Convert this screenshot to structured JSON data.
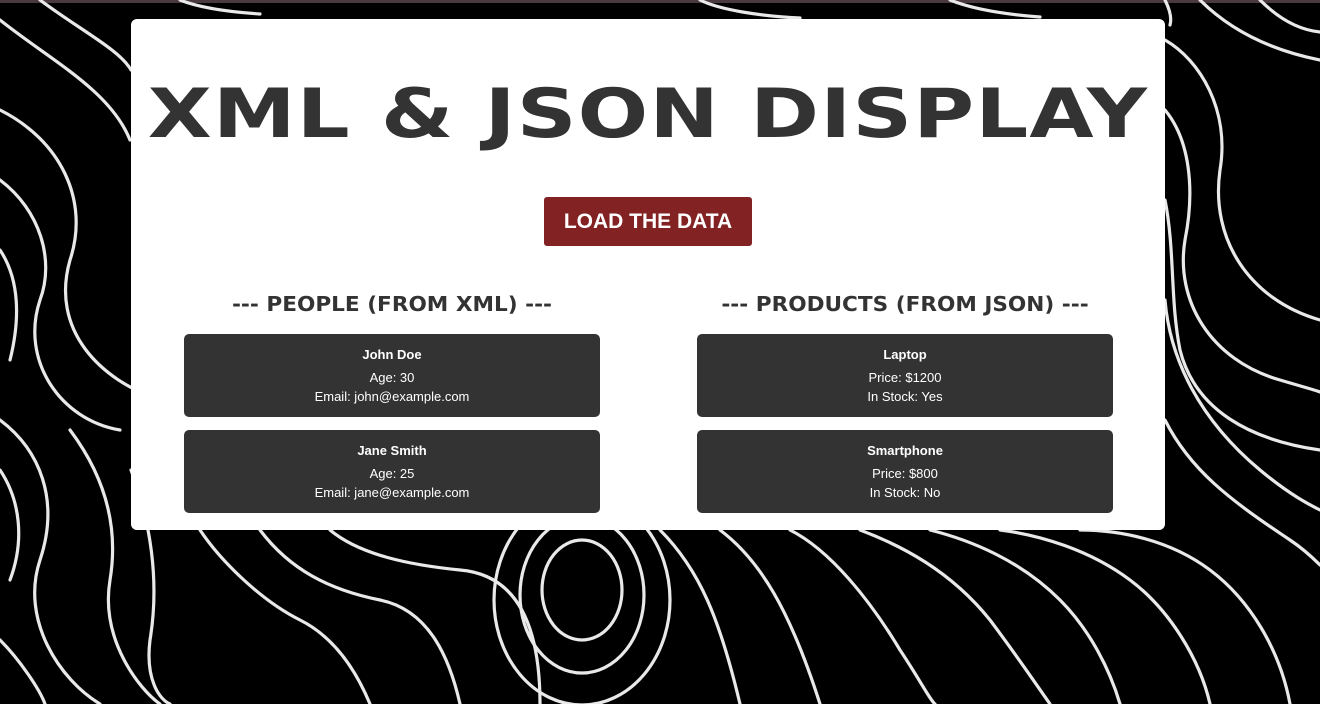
{
  "page": {
    "title": "XML & JSON DISPLAY",
    "load_button": "LOAD THE DATA",
    "accent_color": "#822222"
  },
  "people": {
    "heading": "--- PEOPLE (FROM XML) ---",
    "items": [
      {
        "name": "John Doe",
        "age": "Age: 30",
        "email": "Email: john@example.com"
      },
      {
        "name": "Jane Smith",
        "age": "Age: 25",
        "email": "Email: jane@example.com"
      }
    ]
  },
  "products": {
    "heading": "--- PRODUCTS (FROM JSON) ---",
    "items": [
      {
        "name": "Laptop",
        "price": "Price: $1200",
        "stock": "In Stock: Yes"
      },
      {
        "name": "Smartphone",
        "price": "Price: $800",
        "stock": "In Stock: No"
      }
    ]
  }
}
